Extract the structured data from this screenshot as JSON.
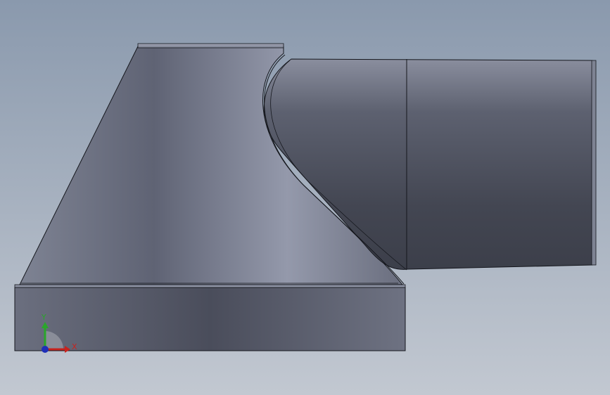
{
  "viewport": {
    "triad": {
      "y_label": "Y",
      "x_label": "X",
      "colors": {
        "x": "#c8231e",
        "y": "#2aa62a",
        "z": "#1f2fb8"
      }
    }
  }
}
